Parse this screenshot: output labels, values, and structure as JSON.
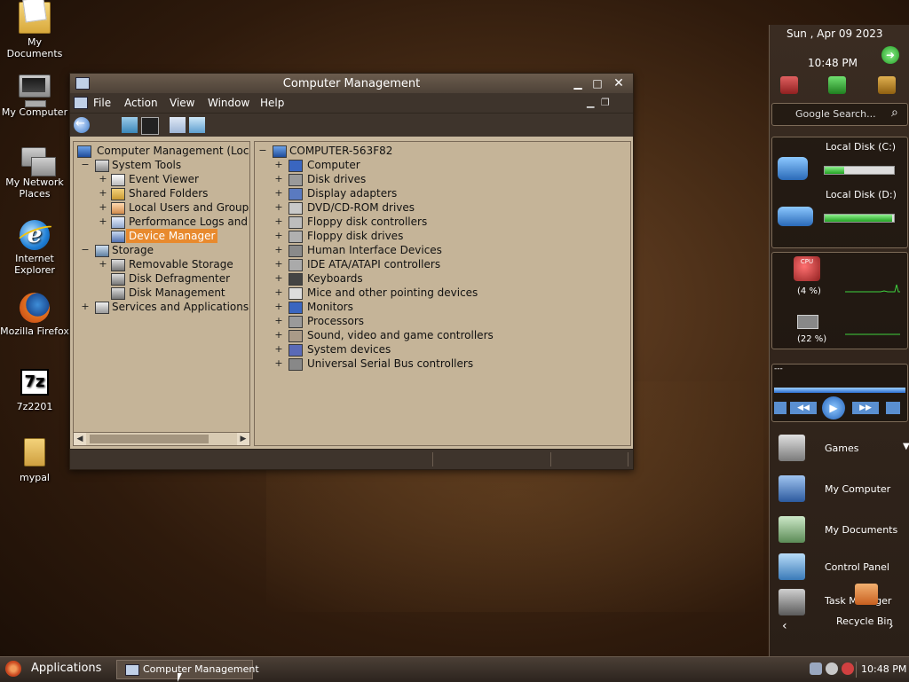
{
  "desktop": {
    "icons": [
      {
        "label": "My Documents"
      },
      {
        "label": "My Computer"
      },
      {
        "label": "My Network Places"
      },
      {
        "label": "Internet Explorer"
      },
      {
        "label": "Mozilla Firefox"
      },
      {
        "label": "7z2201"
      },
      {
        "label": "mypal"
      }
    ]
  },
  "window": {
    "title": "Computer Management",
    "menu": [
      "File",
      "Action",
      "View",
      "Window",
      "Help"
    ],
    "tree": [
      {
        "label": "Computer Management (Local",
        "expander": ""
      },
      {
        "label": "System Tools",
        "expander": "−"
      },
      {
        "label": "Event Viewer",
        "expander": "+"
      },
      {
        "label": "Shared Folders",
        "expander": "+"
      },
      {
        "label": "Local Users and Groups",
        "expander": "+"
      },
      {
        "label": "Performance Logs and A",
        "expander": "+"
      },
      {
        "label": "Device Manager",
        "expander": "",
        "selected": true
      },
      {
        "label": "Storage",
        "expander": "−"
      },
      {
        "label": "Removable Storage",
        "expander": "+"
      },
      {
        "label": "Disk Defragmenter",
        "expander": ""
      },
      {
        "label": "Disk Management",
        "expander": ""
      },
      {
        "label": "Services and Applications",
        "expander": "+"
      }
    ],
    "devices": {
      "root": "COMPUTER-563F82",
      "root_expander": "−",
      "items": [
        "Computer",
        "Disk drives",
        "Display adapters",
        "DVD/CD-ROM drives",
        "Floppy disk controllers",
        "Floppy disk drives",
        "Human Interface Devices",
        "IDE ATA/ATAPI controllers",
        "Keyboards",
        "Mice and other pointing devices",
        "Monitors",
        "Processors",
        "Sound, video and game controllers",
        "System devices",
        "Universal Serial Bus controllers"
      ],
      "item_expander": "+"
    }
  },
  "sidebar": {
    "date": "Sun , Apr 09 2023",
    "time": "10:48 PM",
    "search_placeholder": "Google Search...",
    "disks": [
      {
        "label": "Local Disk (C:)",
        "fill": 0.28
      },
      {
        "label": "Local Disk (D:)",
        "fill": 0.97
      }
    ],
    "cpu_label": "(4 %)",
    "cpu_badge": "CPU",
    "ram_label": "(22 %)",
    "player_text": "---",
    "dock": [
      {
        "label": "Games"
      },
      {
        "label": "My Computer"
      },
      {
        "label": "My Documents"
      },
      {
        "label": "Control Panel"
      },
      {
        "label": "Task Manager"
      },
      {
        "label": "Recycle Bin"
      }
    ]
  },
  "taskbar": {
    "apps_label": "Applications",
    "task_label": "Computer Management",
    "clock": "10:48 PM"
  },
  "colors": {
    "selection": "#e88a2e",
    "window_bg": "#c8b89e",
    "bar_chrome": "#3e342c"
  }
}
